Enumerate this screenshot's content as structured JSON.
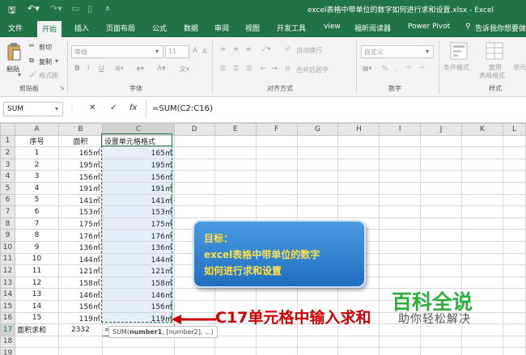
{
  "window": {
    "title": "excel表格中带单位的数字如何进行求和设置.xlsx - Excel"
  },
  "tabs": [
    "文件",
    "开始",
    "插入",
    "页面布局",
    "公式",
    "数据",
    "审阅",
    "视图",
    "开发工具",
    "view",
    "福昕阅读器",
    "Power Pivot",
    "告诉我你想要做什么"
  ],
  "ribbon": {
    "paste": "粘贴",
    "cut": "剪切",
    "copy": "复制",
    "format_painter": "格式刷",
    "clipboard": "剪贴板",
    "font_name": "等线",
    "font_size": "11",
    "font_group": "字体",
    "wrap_text": "自动换行",
    "merge_center": "合并后居中",
    "alignment_group": "对齐方式",
    "number_format": "自定义",
    "number_group": "数字",
    "cond_format": "条件格式",
    "table_format": "套用\n表格格式",
    "cell_styles": "单元",
    "styles_group": "样式"
  },
  "formula_bar": {
    "name_box": "SUM",
    "cancel": "✕",
    "enter": "✓",
    "fx": "fx",
    "formula": "=SUM(C2:C16)"
  },
  "columns": [
    "A",
    "B",
    "C",
    "D",
    "E",
    "F",
    "G",
    "H",
    "I",
    "J",
    "K",
    "L"
  ],
  "header_row": [
    "序号",
    "面积",
    "设置单元格格式"
  ],
  "rows": [
    {
      "no": "1",
      "area": "165㎡",
      "fmt": "165㎡"
    },
    {
      "no": "2",
      "area": "195㎡",
      "fmt": "195㎡"
    },
    {
      "no": "3",
      "area": "156㎡",
      "fmt": "156㎡"
    },
    {
      "no": "4",
      "area": "191㎡",
      "fmt": "191㎡"
    },
    {
      "no": "5",
      "area": "141㎡",
      "fmt": "141㎡"
    },
    {
      "no": "6",
      "area": "153㎡",
      "fmt": "153㎡"
    },
    {
      "no": "7",
      "area": "175㎡",
      "fmt": "175㎡"
    },
    {
      "no": "8",
      "area": "176㎡",
      "fmt": "176㎡"
    },
    {
      "no": "9",
      "area": "136㎡",
      "fmt": "136㎡"
    },
    {
      "no": "10",
      "area": "144㎡",
      "fmt": "144㎡"
    },
    {
      "no": "11",
      "area": "121㎡",
      "fmt": "121㎡"
    },
    {
      "no": "12",
      "area": "158㎡",
      "fmt": "158㎡"
    },
    {
      "no": "13",
      "area": "146㎡",
      "fmt": "146㎡"
    },
    {
      "no": "14",
      "area": "156㎡",
      "fmt": "156㎡"
    },
    {
      "no": "15",
      "area": "119㎡",
      "fmt": "119㎡"
    }
  ],
  "total_row": {
    "label": "面积求和",
    "value": "2332",
    "formula_prefix": "=SUM(",
    "formula_ref": "C2:C16",
    "formula_suffix": ")"
  },
  "tooltip": {
    "fn": "SUM(",
    "arg1": "number1",
    "rest": ", [number2], ...)"
  },
  "callout": {
    "line1": "目标：",
    "line2": "excel表格中带单位的数字",
    "line3": "如何进行求和设置"
  },
  "annotation": "C17单元格中输入求和",
  "watermark": {
    "title": "百科全说",
    "subtitle": "助你轻松解决"
  },
  "colors": {
    "accent": "#217346",
    "callout": "#2f86d6",
    "annotation": "#d00000",
    "watermark": "#2fae3e"
  }
}
